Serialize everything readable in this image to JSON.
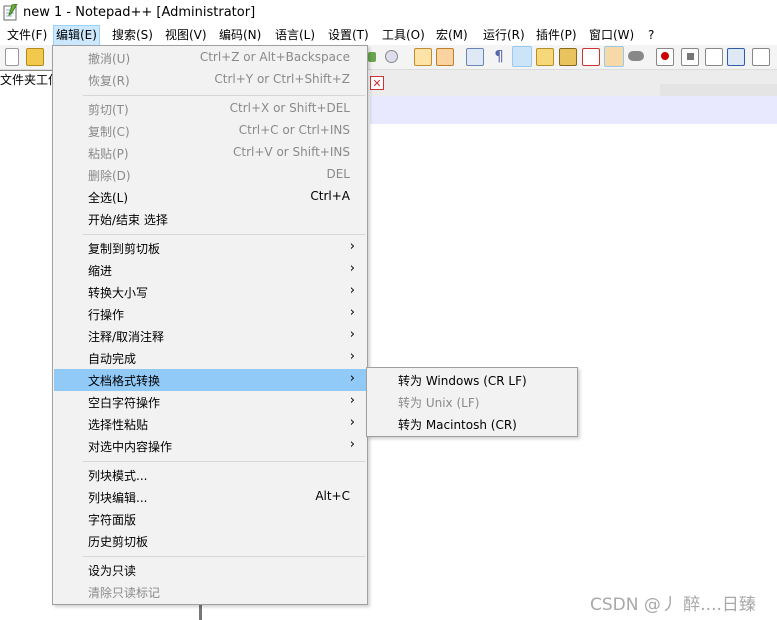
{
  "window": {
    "title": "new 1 - Notepad++ [Administrator]"
  },
  "menubar": [
    {
      "label": "文件(F)",
      "active": false
    },
    {
      "label": "编辑(E)",
      "active": true
    },
    {
      "label": "搜索(S)",
      "active": false
    },
    {
      "label": "视图(V)",
      "active": false
    },
    {
      "label": "编码(N)",
      "active": false
    },
    {
      "label": "语言(L)",
      "active": false
    },
    {
      "label": "设置(T)",
      "active": false
    },
    {
      "label": "工具(O)",
      "active": false
    },
    {
      "label": "宏(M)",
      "active": false
    },
    {
      "label": "运行(R)",
      "active": false
    },
    {
      "label": "插件(P)",
      "active": false
    },
    {
      "label": "窗口(W)",
      "active": false
    },
    {
      "label": "?",
      "active": false
    }
  ],
  "left_panel": {
    "tab_label": "文件夹工作"
  },
  "edit_menu": [
    {
      "label": "撤消(U)",
      "shortcut": "Ctrl+Z or Alt+Backspace",
      "disabled": true
    },
    {
      "label": "恢复(R)",
      "shortcut": "Ctrl+Y or Ctrl+Shift+Z",
      "disabled": true
    },
    {
      "separator": true
    },
    {
      "label": "剪切(T)",
      "shortcut": "Ctrl+X or Shift+DEL",
      "disabled": true
    },
    {
      "label": "复制(C)",
      "shortcut": "Ctrl+C or Ctrl+INS",
      "disabled": true
    },
    {
      "label": "粘贴(P)",
      "shortcut": "Ctrl+V or Shift+INS",
      "disabled": true
    },
    {
      "label": "删除(D)",
      "shortcut": "DEL",
      "disabled": true
    },
    {
      "label": "全选(L)",
      "shortcut": "Ctrl+A",
      "disabled": false
    },
    {
      "label": "开始/结束 选择",
      "shortcut": "",
      "disabled": false
    },
    {
      "separator": true
    },
    {
      "label": "复制到剪切板",
      "submenu": true
    },
    {
      "label": "缩进",
      "submenu": true
    },
    {
      "label": "转换大小写",
      "submenu": true
    },
    {
      "label": "行操作",
      "submenu": true
    },
    {
      "label": "注释/取消注释",
      "submenu": true
    },
    {
      "label": "自动完成",
      "submenu": true
    },
    {
      "label": "文档格式转换",
      "submenu": true,
      "highlighted": true
    },
    {
      "label": "空白字符操作",
      "submenu": true
    },
    {
      "label": "选择性粘贴",
      "submenu": true
    },
    {
      "label": "对选中内容操作",
      "submenu": true
    },
    {
      "separator": true
    },
    {
      "label": "列块模式...",
      "shortcut": ""
    },
    {
      "label": "列块编辑...",
      "shortcut": "Alt+C"
    },
    {
      "label": "字符面版",
      "shortcut": ""
    },
    {
      "label": "历史剪切板",
      "shortcut": ""
    },
    {
      "separator": true
    },
    {
      "label": "设为只读",
      "shortcut": ""
    },
    {
      "label": "清除只读标记",
      "shortcut": "",
      "disabled": true
    }
  ],
  "eol_submenu": [
    {
      "label": "转为 Windows (CR LF)",
      "disabled": false
    },
    {
      "label": "转为 Unix (LF)",
      "disabled": true
    },
    {
      "label": "转为 Macintosh (CR)",
      "disabled": false
    }
  ],
  "icons": {
    "submenu_arrow": "›",
    "tab_close": "✕"
  },
  "colors": {
    "menu_highlight": "#91c9f7",
    "active_menubar": "#cce8ff",
    "current_line": "#e8e8ff",
    "disabled_text": "#8a8a8a"
  },
  "watermark": "CSDN @丿 醉....日臻"
}
